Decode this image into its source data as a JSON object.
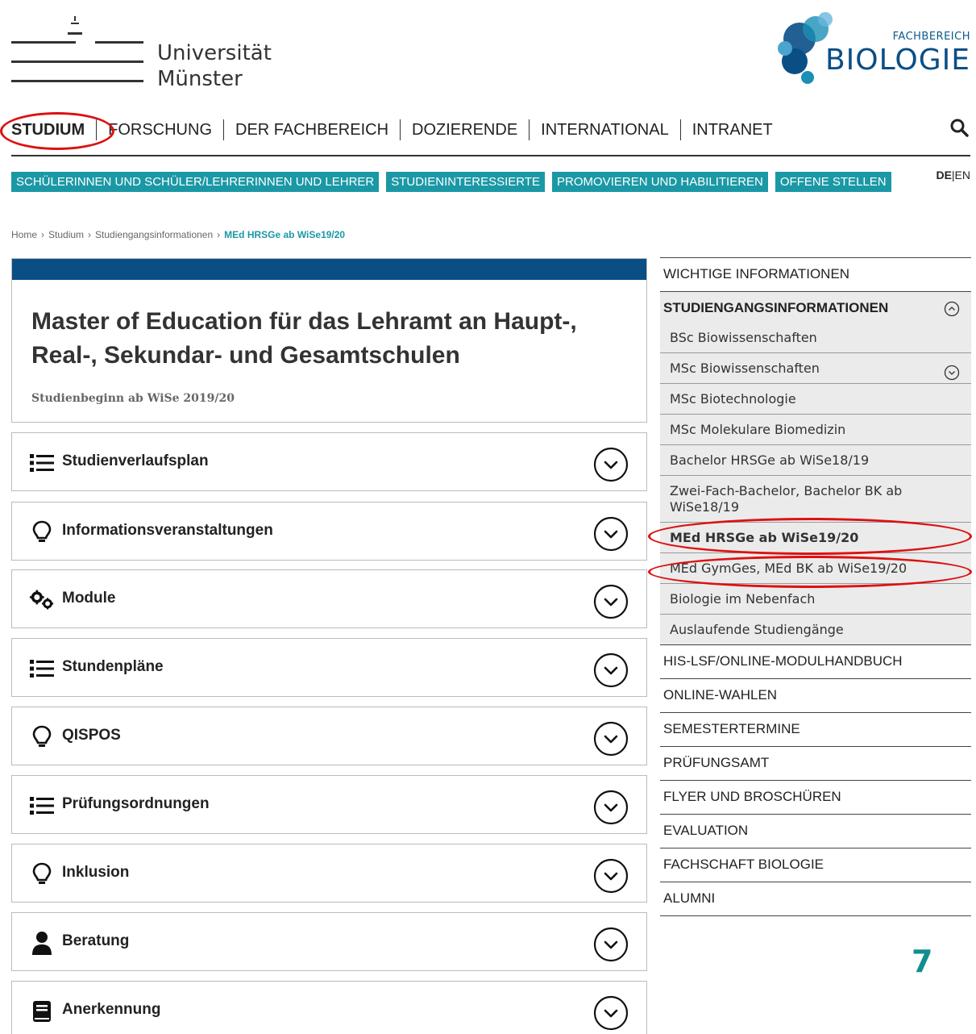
{
  "header": {
    "university": [
      "Universität",
      "Münster"
    ],
    "faculty_small": "FACHBEREICH",
    "faculty_big": "BIOLOGIE"
  },
  "mainnav": [
    "STUDIUM",
    "FORSCHUNG",
    "DER FACHBEREICH",
    "DOZIERENDE",
    "INTERNATIONAL",
    "INTRANET"
  ],
  "subnav": [
    "SCHÜLERINNEN UND SCHÜLER/LEHRERINNEN UND LEHRER",
    "STUDIENINTERESSIERTE",
    "PROMOVIEREN UND HABILITIEREN",
    "OFFENE STELLEN"
  ],
  "lang": {
    "de": "DE",
    "sep": "|",
    "en": "EN"
  },
  "breadcrumb": [
    "Home",
    "Studium",
    "Studiengangsinformationen",
    "MEd HRSGe ab WiSe19/20"
  ],
  "breadcrumb_sep": "›",
  "title": {
    "heading": "Master of Education für das Lehramt an Haupt-, Real-, Sekundar- und Gesamtschulen",
    "subtitle": "Studienbeginn ab WiSe 2019/20"
  },
  "accordion": [
    {
      "label": "Studienverlaufsplan",
      "icon": "list-icon"
    },
    {
      "label": "Informationsveranstaltungen",
      "icon": "lightbulb-icon"
    },
    {
      "label": "Module",
      "icon": "gears-icon"
    },
    {
      "label": "Stundenpläne",
      "icon": "list-icon"
    },
    {
      "label": "QISPOS",
      "icon": "lightbulb-icon"
    },
    {
      "label": "Prüfungsordnungen",
      "icon": "list-icon"
    },
    {
      "label": "Inklusion",
      "icon": "lightbulb-icon"
    },
    {
      "label": "Beratung",
      "icon": "user-icon"
    },
    {
      "label": "Anerkennung",
      "icon": "book-icon"
    }
  ],
  "sidebar": {
    "top": "WICHTIGE INFORMATIONEN",
    "active": "STUDIENGANGSINFORMATIONEN",
    "sub": [
      "BSc Biowissenschaften",
      "MSc Biowissenschaften",
      "MSc Biotechnologie",
      "MSc Molekulare Biomedizin",
      "Bachelor HRSGe ab WiSe18/19",
      "Zwei-Fach-Bachelor, Bachelor BK ab WiSe18/19",
      "MEd HRSGe ab WiSe19/20",
      "MEd GymGes, MEd BK ab WiSe19/20",
      "Biologie im Nebenfach",
      "Auslaufende Studiengänge"
    ],
    "rest": [
      "HIS-LSF/ONLINE-MODULHANDBUCH",
      "ONLINE-WAHLEN",
      "SEMESTERTERMINE",
      "PRÜFUNGSAMT",
      "FLYER UND BROSCHÜREN",
      "EVALUATION",
      "FACHSCHAFT BIOLOGIE",
      "ALUMNI"
    ]
  },
  "page_number": "7",
  "colors": {
    "teal": "#1b98a5",
    "navy": "#0a4e86",
    "annotation": "#dd1111"
  }
}
